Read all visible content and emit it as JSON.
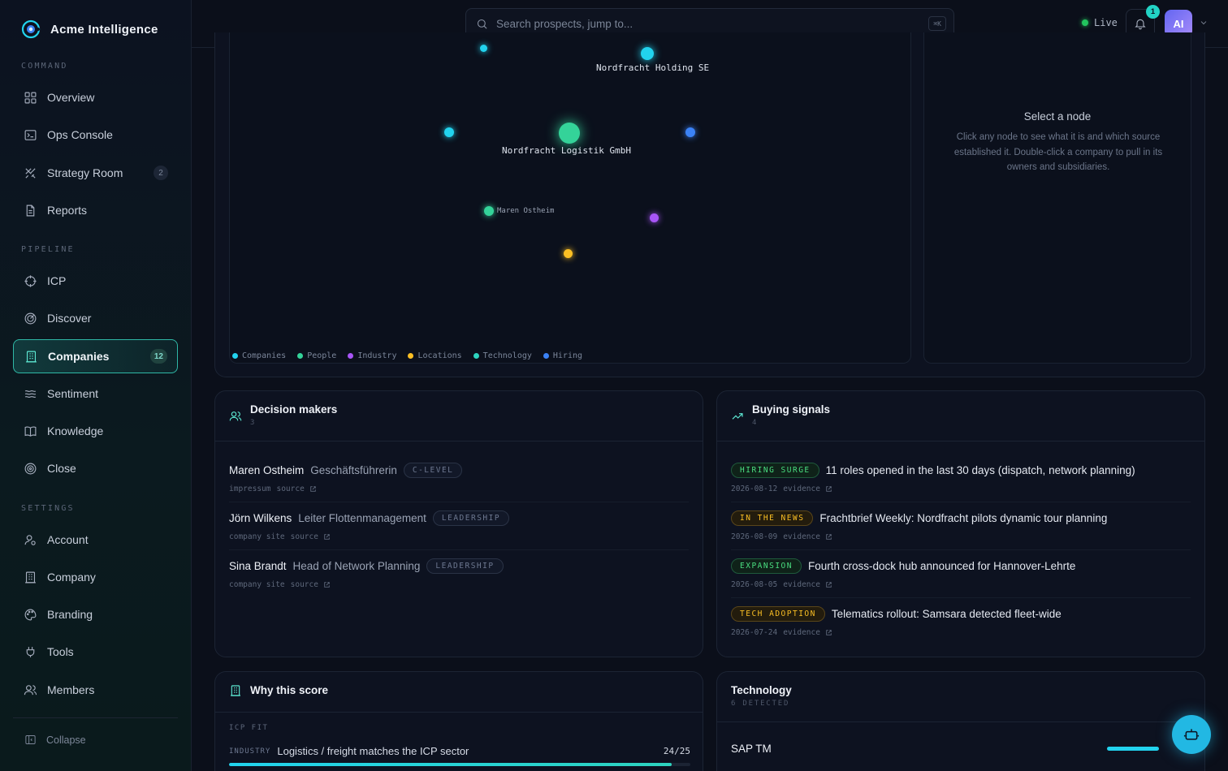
{
  "app": {
    "name": "Acme Intelligence"
  },
  "sidebar": {
    "sections": [
      {
        "label": "COMMAND"
      },
      {
        "label": "PIPELINE"
      },
      {
        "label": "SETTINGS"
      }
    ],
    "items": [
      {
        "label": "Overview",
        "icon": "grid-icon"
      },
      {
        "label": "Ops Console",
        "icon": "terminal-icon"
      },
      {
        "label": "Strategy Room",
        "icon": "swords-icon",
        "badge": "2"
      },
      {
        "label": "Reports",
        "icon": "document-icon"
      },
      {
        "label": "ICP",
        "icon": "crosshair-icon"
      },
      {
        "label": "Discover",
        "icon": "radar-icon"
      },
      {
        "label": "Companies",
        "icon": "building-icon",
        "badge": "12",
        "active": true
      },
      {
        "label": "Sentiment",
        "icon": "waves-icon"
      },
      {
        "label": "Knowledge",
        "icon": "book-icon"
      },
      {
        "label": "Close",
        "icon": "target-icon"
      },
      {
        "label": "Account",
        "icon": "user-cog-icon"
      },
      {
        "label": "Company",
        "icon": "building-icon"
      },
      {
        "label": "Branding",
        "icon": "palette-icon"
      },
      {
        "label": "Tools",
        "icon": "plug-icon"
      },
      {
        "label": "Members",
        "icon": "users-icon"
      }
    ],
    "collapse_label": "Collapse"
  },
  "topbar": {
    "search_placeholder": "Search prospects, jump to...",
    "shortcut": "⌘K",
    "live_label": "Live",
    "notification_count": "1",
    "avatar_initials": "AI"
  },
  "graph": {
    "nodes": [
      {
        "label": "Nordfracht Holding SE",
        "category": "Companies"
      },
      {
        "label": "Nordfracht Logistik GmbH",
        "category": "People"
      },
      {
        "label": "Maren Ostheim",
        "category": "People"
      }
    ],
    "legend": [
      {
        "label": "Companies",
        "color": "#22d3ee"
      },
      {
        "label": "People",
        "color": "#34d399"
      },
      {
        "label": "Industry",
        "color": "#a855f7"
      },
      {
        "label": "Locations",
        "color": "#fbbf24"
      },
      {
        "label": "Technology",
        "color": "#2dd4bf"
      },
      {
        "label": "Hiring",
        "color": "#3b82f6"
      }
    ],
    "panel_title": "Select a node",
    "panel_body": "Click any node to see what it is and which source established it. Double-click a company to pull in its owners and subsidiaries."
  },
  "decision_makers": {
    "title": "Decision makers",
    "count": "3",
    "rows": [
      {
        "name": "Maren Ostheim",
        "role": "Geschäftsführerin",
        "tag": "C-LEVEL",
        "source": "impressum",
        "link": "source"
      },
      {
        "name": "Jörn Wilkens",
        "role": "Leiter Flottenmanagement",
        "tag": "LEADERSHIP",
        "source": "company site",
        "link": "source"
      },
      {
        "name": "Sina Brandt",
        "role": "Head of Network Planning",
        "tag": "LEADERSHIP",
        "source": "company site",
        "link": "source"
      }
    ]
  },
  "buying_signals": {
    "title": "Buying signals",
    "count": "4",
    "rows": [
      {
        "tag": "HIRING SURGE",
        "tone": "green",
        "text": "11 roles opened in the last 30 days (dispatch, network planning)",
        "date": "2026-08-12",
        "link": "evidence"
      },
      {
        "tag": "IN THE NEWS",
        "tone": "amber",
        "text": "Frachtbrief Weekly: Nordfracht pilots dynamic tour planning",
        "date": "2026-08-09",
        "link": "evidence"
      },
      {
        "tag": "EXPANSION",
        "tone": "green",
        "text": "Fourth cross-dock hub announced for Hannover-Lehrte",
        "date": "2026-08-05",
        "link": "evidence"
      },
      {
        "tag": "TECH ADOPTION",
        "tone": "amber",
        "text": "Telematics rollout: Samsara detected fleet-wide",
        "date": "2026-07-24",
        "link": "evidence"
      }
    ]
  },
  "score": {
    "title": "Why this score",
    "section": "ICP FIT",
    "row_label": "INDUSTRY",
    "row_text": "Logistics / freight matches the ICP sector",
    "row_value": "24/25",
    "fill_fraction": 0.96
  },
  "technology": {
    "title": "Technology",
    "subtitle": "6 DETECTED",
    "rows": [
      {
        "name": "SAP TM"
      }
    ]
  }
}
